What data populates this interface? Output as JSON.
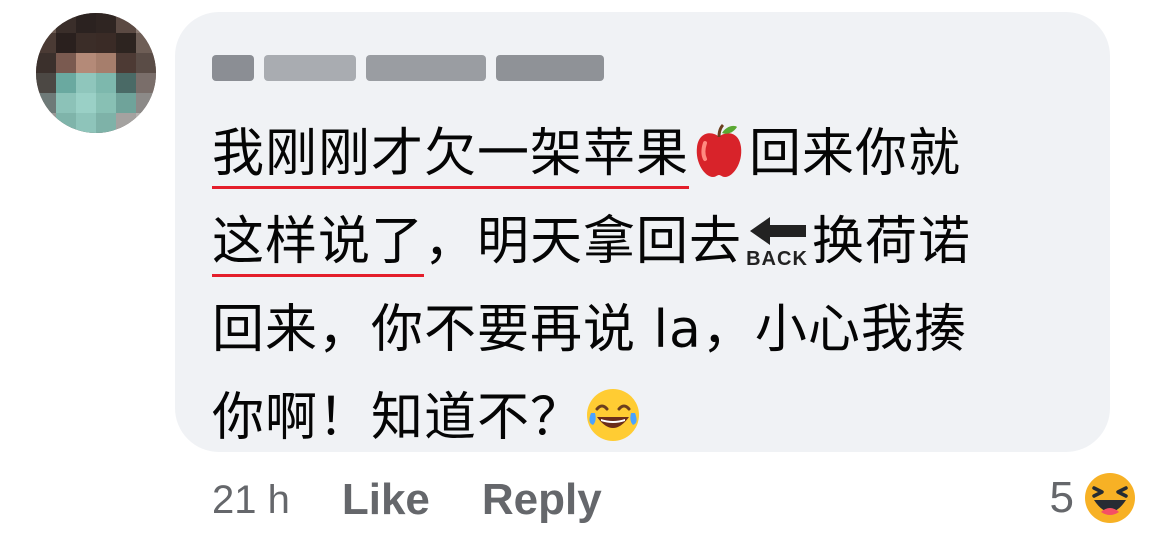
{
  "comment": {
    "lines": [
      {
        "underlined": "我刚刚才欠一架苹果",
        "rest": "回来你就"
      },
      {
        "underlined": "这样说了",
        "rest": "，明天拿回去"
      },
      {
        "text": "回来，你不要再说 la，小心我揍"
      },
      {
        "text": "你啊！知道不？"
      }
    ],
    "line2_after_back": "换荷诺",
    "emoji_inline": [
      "red-apple",
      "back-arrow",
      "joy-face"
    ],
    "back_label": "BACK"
  },
  "footer": {
    "time": "21 h",
    "like_label": "Like",
    "reply_label": "Reply"
  },
  "reactions": {
    "count": "5",
    "icon": "haha-reaction-icon"
  },
  "colors": {
    "bubble": "#f0f2f5",
    "text": "#050505",
    "meta": "#65676b",
    "spell_underline": "#e41e2b"
  }
}
